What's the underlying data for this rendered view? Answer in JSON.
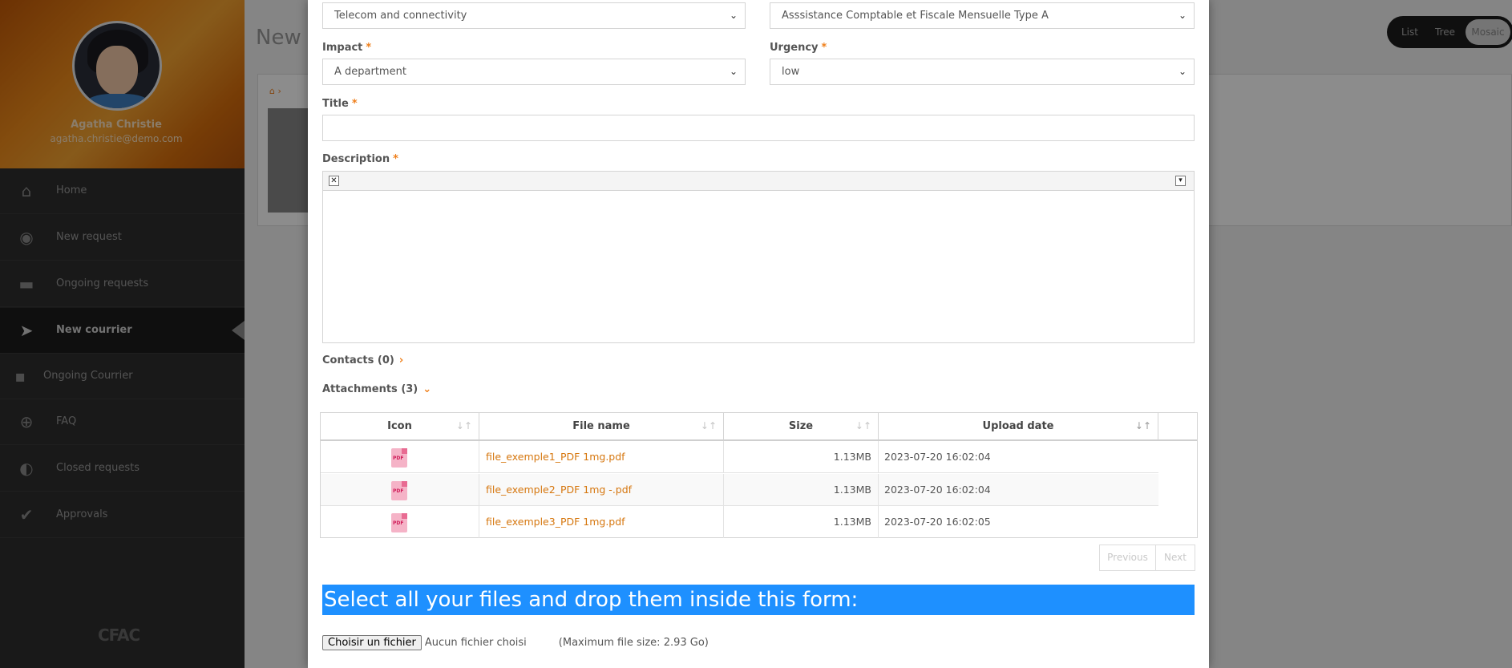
{
  "sidebar": {
    "profile_name": "Agatha Christie",
    "profile_email": "agatha.christie@demo.com",
    "items": [
      {
        "label": "Home",
        "icon": "home-icon"
      },
      {
        "label": "New request",
        "icon": "eye-icon"
      },
      {
        "label": "Ongoing requests",
        "icon": "chat-icon"
      },
      {
        "label": "New courrier",
        "icon": "paper-plane-icon"
      },
      {
        "label": "Ongoing Courrier",
        "icon": "truck-icon"
      },
      {
        "label": "FAQ",
        "icon": "plus-circle-icon"
      },
      {
        "label": "Closed requests",
        "icon": "toggle-icon"
      },
      {
        "label": "Approvals",
        "icon": "check-circle-icon"
      }
    ],
    "logo_text": "CFAC"
  },
  "background": {
    "title": "New c",
    "view_toggle": [
      "List",
      "Tree",
      "Mosaic"
    ]
  },
  "form": {
    "category_value": "Telecom and connectivity",
    "service_value": "Asssistance Comptable et Fiscale Mensuelle Type A",
    "impact_label": "Impact",
    "impact_value": "A department",
    "urgency_label": "Urgency",
    "urgency_value": "low",
    "title_label": "Title",
    "title_value": "",
    "description_label": "Description",
    "required_mark": "*",
    "contacts_label": "Contacts (0)",
    "attachments_label": "Attachments (3)"
  },
  "attachments_table": {
    "columns": [
      "Icon",
      "File name",
      "Size",
      "Upload date"
    ],
    "rows": [
      {
        "icon": "pdf-icon",
        "icon_text": "PDF",
        "name": "file_exemple1_PDF 1mg.pdf",
        "size": "1.13MB",
        "date": "2023-07-20 16:02:04"
      },
      {
        "icon": "pdf-icon",
        "icon_text": "PDF",
        "name": "file_exemple2_PDF 1mg -.pdf",
        "size": "1.13MB",
        "date": "2023-07-20 16:02:04"
      },
      {
        "icon": "pdf-icon",
        "icon_text": "PDF",
        "name": "file_exemple3_PDF 1mg.pdf",
        "size": "1.13MB",
        "date": "2023-07-20 16:02:05"
      }
    ],
    "pager": {
      "previous": "Previous",
      "next": "Next"
    }
  },
  "upload": {
    "banner": "Select all your files and drop them inside this form:",
    "button_label": "Choisir un fichier",
    "status": "Aucun fichier choisi",
    "max_size": "(Maximum file size: 2.93 Go)"
  },
  "colors": {
    "accent": "#ef7f1a",
    "banner": "#1e90ff",
    "link": "#d6770f"
  }
}
